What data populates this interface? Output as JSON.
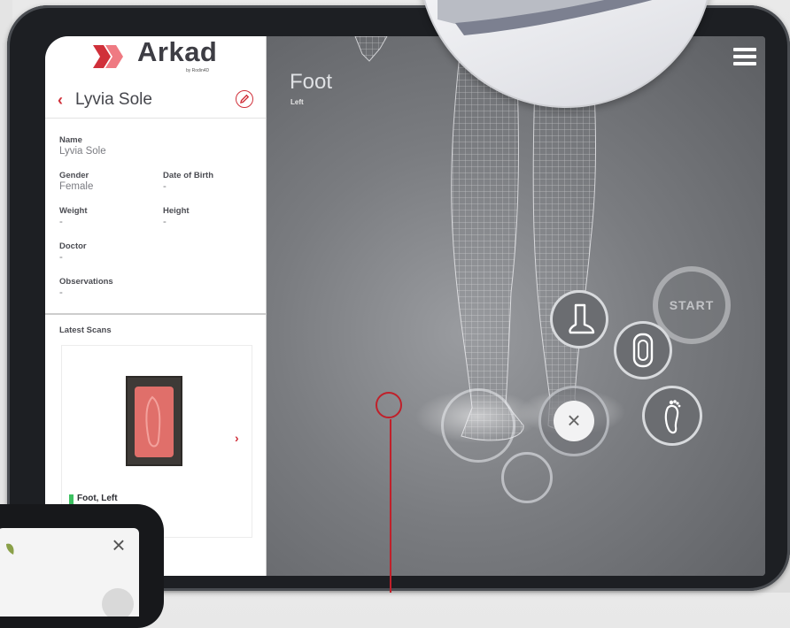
{
  "logo": {
    "name": "Arkad",
    "sub": "by Rodin4D"
  },
  "patient": {
    "name": "Lyvia Sole"
  },
  "info": {
    "name_label": "Name",
    "name_value": "Lyvia Sole",
    "gender_label": "Gender",
    "gender_value": "Female",
    "dob_label": "Date of Birth",
    "dob_value": "-",
    "weight_label": "Weight",
    "weight_value": "-",
    "height_label": "Height",
    "height_value": "-",
    "doctor_label": "Doctor",
    "doctor_value": "-",
    "observations_label": "Observations",
    "observations_value": "-"
  },
  "latest_scans": {
    "label": "Latest Scans",
    "card_caption": "Foot, Left"
  },
  "viewer": {
    "title": "Foot",
    "side": "Left",
    "start_label": "START"
  },
  "colors": {
    "accent": "#d0303a",
    "status_green": "#3cc060"
  },
  "icons": {
    "back": "chevron-left-icon",
    "edit": "pencil-icon",
    "menu": "hamburger-icon",
    "close": "close-icon",
    "side_view": "foot-side-icon",
    "sole_view": "foot-sole-icon",
    "top_view": "foot-top-icon"
  }
}
